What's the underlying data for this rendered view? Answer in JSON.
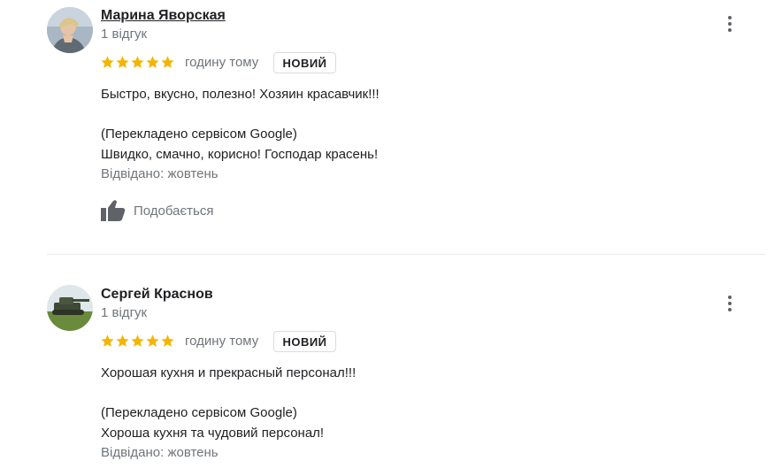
{
  "colors": {
    "star": "#f4b400",
    "secondary_text": "#70757a",
    "primary_text": "#202124",
    "divider": "#e8eaed"
  },
  "reviews": [
    {
      "author": "Марина Яворская",
      "review_count": "1 відгук",
      "rating": 5,
      "time": "годину тому",
      "badge": "НОВИЙ",
      "original_text": "Быстро, вкусно, полезно! Хозяин красавчик!!!",
      "translation_note": "(Перекладено сервісом Google)",
      "translated_text": "Швидко, смачно, корисно! Господар красень!",
      "visited": "Відвідано: жовтень",
      "like_label": "Подобається",
      "avatar_icon": "person-photo-icon"
    },
    {
      "author": "Сергей Краснов",
      "review_count": "1 відгук",
      "rating": 5,
      "time": "годину тому",
      "badge": "НОВИЙ",
      "original_text": "Хорошая кухня и прекрасный персонал!!!",
      "translation_note": "(Перекладено сервісом Google)",
      "translated_text": "Хороша кухня та чудовий персонал!",
      "visited": "Відвідано: жовтень",
      "avatar_icon": "tank-photo-icon"
    }
  ]
}
